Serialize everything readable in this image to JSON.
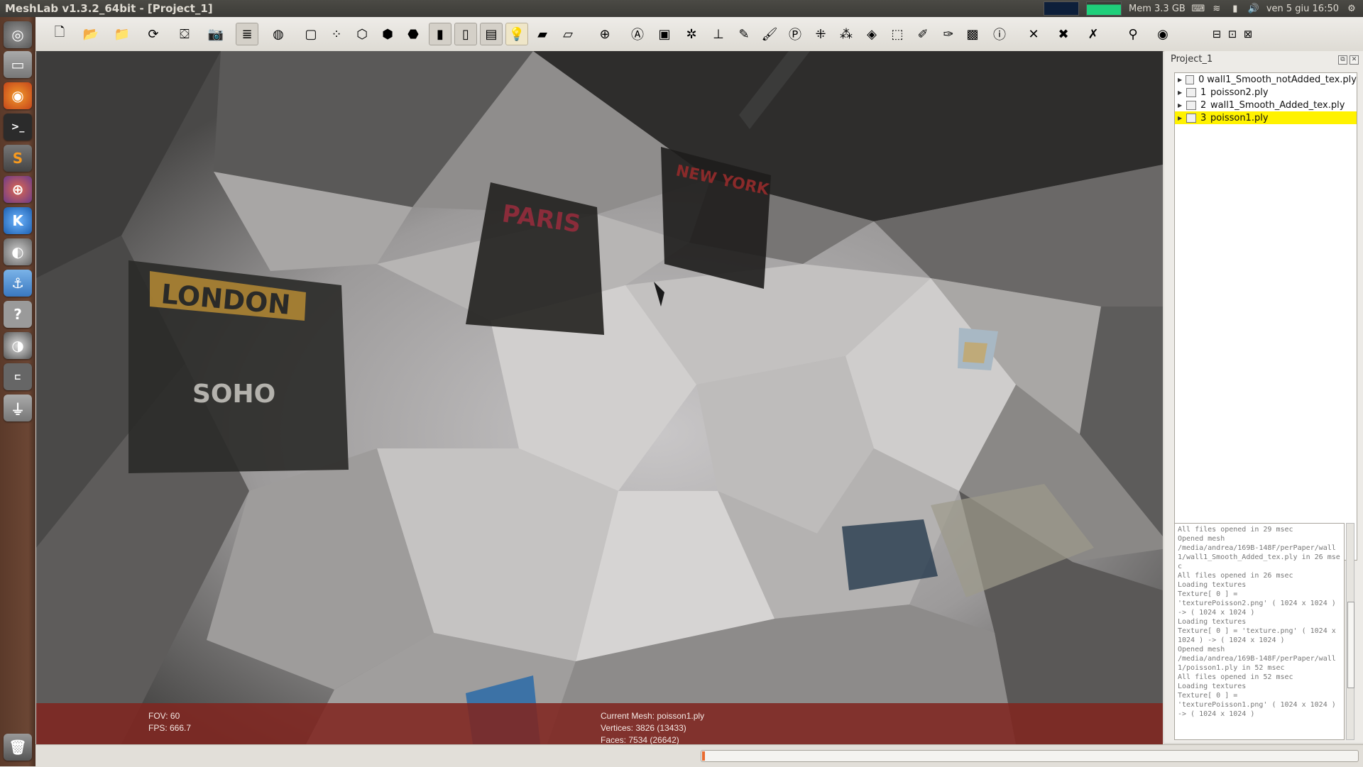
{
  "window": {
    "title": "MeshLab v1.3.2_64bit - [Project_1]"
  },
  "tray": {
    "mem": "Mem 3.3 GB",
    "datetime": "ven 5 giu 16:50"
  },
  "launcher": {
    "apps": [
      {
        "name": "dash-home-icon"
      },
      {
        "name": "files-icon"
      },
      {
        "name": "firefox-icon"
      },
      {
        "name": "terminal-icon"
      },
      {
        "name": "sublime-text-icon"
      },
      {
        "name": "app-icon-5"
      },
      {
        "name": "app-icon-6"
      },
      {
        "name": "app-icon-7"
      },
      {
        "name": "app-icon-8"
      },
      {
        "name": "help-icon"
      },
      {
        "name": "eye-app-icon"
      },
      {
        "name": "app-icon-11"
      },
      {
        "name": "usb-drive-icon"
      },
      {
        "name": "trash-icon"
      }
    ]
  },
  "toolbar": {
    "buttons": [
      {
        "name": "new-project-icon",
        "glyph": "🗋"
      },
      {
        "name": "open-project-icon",
        "glyph": "📂"
      },
      {
        "name": "import-mesh-icon",
        "glyph": "📁"
      },
      {
        "name": "reload-icon",
        "glyph": "⟳"
      },
      {
        "name": "export-mesh-icon",
        "glyph": "⛋"
      },
      {
        "name": "snapshot-icon",
        "glyph": "📷"
      },
      {
        "name": "layers-icon",
        "glyph": "≣"
      },
      {
        "name": "trackball-icon",
        "glyph": "◍"
      },
      {
        "name": "bbox-icon",
        "glyph": "▢"
      },
      {
        "name": "points-icon",
        "glyph": "⁘"
      },
      {
        "name": "wireframe-icon",
        "glyph": "⬡"
      },
      {
        "name": "hidden-lines-icon",
        "glyph": "⬢"
      },
      {
        "name": "flat-lines-icon",
        "glyph": "⬣"
      },
      {
        "name": "flat-icon",
        "glyph": "▮"
      },
      {
        "name": "smooth-icon",
        "glyph": "▯"
      },
      {
        "name": "texture-icon",
        "glyph": "▤"
      },
      {
        "name": "light-icon",
        "glyph": "💡"
      },
      {
        "name": "double-side-icon",
        "glyph": "▰"
      },
      {
        "name": "backface-icon",
        "glyph": "▱"
      },
      {
        "name": "axis-icon",
        "glyph": "⊕"
      },
      {
        "name": "annotation-icon",
        "glyph": "Ⓐ"
      },
      {
        "name": "raster-icon",
        "glyph": "▣"
      },
      {
        "name": "sphere-icon",
        "glyph": "✲"
      },
      {
        "name": "align-icon",
        "glyph": "⊥"
      },
      {
        "name": "measure-icon",
        "glyph": "✎"
      },
      {
        "name": "paint-icon",
        "glyph": "🖌"
      },
      {
        "name": "pick-points-icon",
        "glyph": "Ⓟ"
      },
      {
        "name": "select-vertices-icon",
        "glyph": "⁜"
      },
      {
        "name": "select-faces-icon",
        "glyph": "⁂"
      },
      {
        "name": "color-icon",
        "glyph": "◈"
      },
      {
        "name": "select-rect-icon",
        "glyph": "⬚"
      },
      {
        "name": "edit-icon",
        "glyph": "✐"
      },
      {
        "name": "edit2-icon",
        "glyph": "✑"
      },
      {
        "name": "landscape-icon",
        "glyph": "▩"
      },
      {
        "name": "info-icon",
        "glyph": "ⓘ"
      },
      {
        "name": "delete-vertices-icon",
        "glyph": "✕"
      },
      {
        "name": "delete-faces-icon",
        "glyph": "✖"
      },
      {
        "name": "delete-all-icon",
        "glyph": "✗"
      },
      {
        "name": "search-icon",
        "glyph": "⚲"
      },
      {
        "name": "eye-icon",
        "glyph": "◉"
      }
    ],
    "window_controls": [
      "⊟",
      "⊡",
      "⊠"
    ]
  },
  "viewport": {
    "fov": "FOV: 60",
    "fps": "FPS:  666.7",
    "current_mesh": "Current Mesh: poisson1.ply",
    "vertices": "Vertices: 3826 (13433)",
    "faces": "Faces: 7534 (26642)"
  },
  "panel": {
    "title": "Project_1",
    "layers": [
      {
        "idx": "0",
        "name": "wall1_Smooth_notAdded_tex.ply",
        "selected": false
      },
      {
        "idx": "1",
        "name": "poisson2.ply",
        "selected": false
      },
      {
        "idx": "2",
        "name": "wall1_Smooth_Added_tex.ply",
        "selected": false
      },
      {
        "idx": "3",
        "name": "poisson1.ply",
        "selected": true
      }
    ],
    "log": "All files opened in 29 msec\nOpened mesh\n/media/andrea/169B-148F/perPaper/wall1/wall1_Smooth_Added_tex.ply in 26 msec\nAll files opened in 26 msec\nLoading textures\nTexture[ 0 ] =\n'texturePoisson2.png' ( 1024 x 1024 ) -> ( 1024 x 1024 )\nLoading textures\nTexture[ 0 ] = 'texture.png' ( 1024 x 1024 ) -> ( 1024 x 1024 )\nOpened mesh\n/media/andrea/169B-148F/perPaper/wall1/poisson1.ply in 52 msec\nAll files opened in 52 msec\nLoading textures\nTexture[ 0 ] =\n'texturePoisson1.png' ( 1024 x 1024 ) -> ( 1024 x 1024 )"
  },
  "progress": {
    "value": 0.004
  }
}
